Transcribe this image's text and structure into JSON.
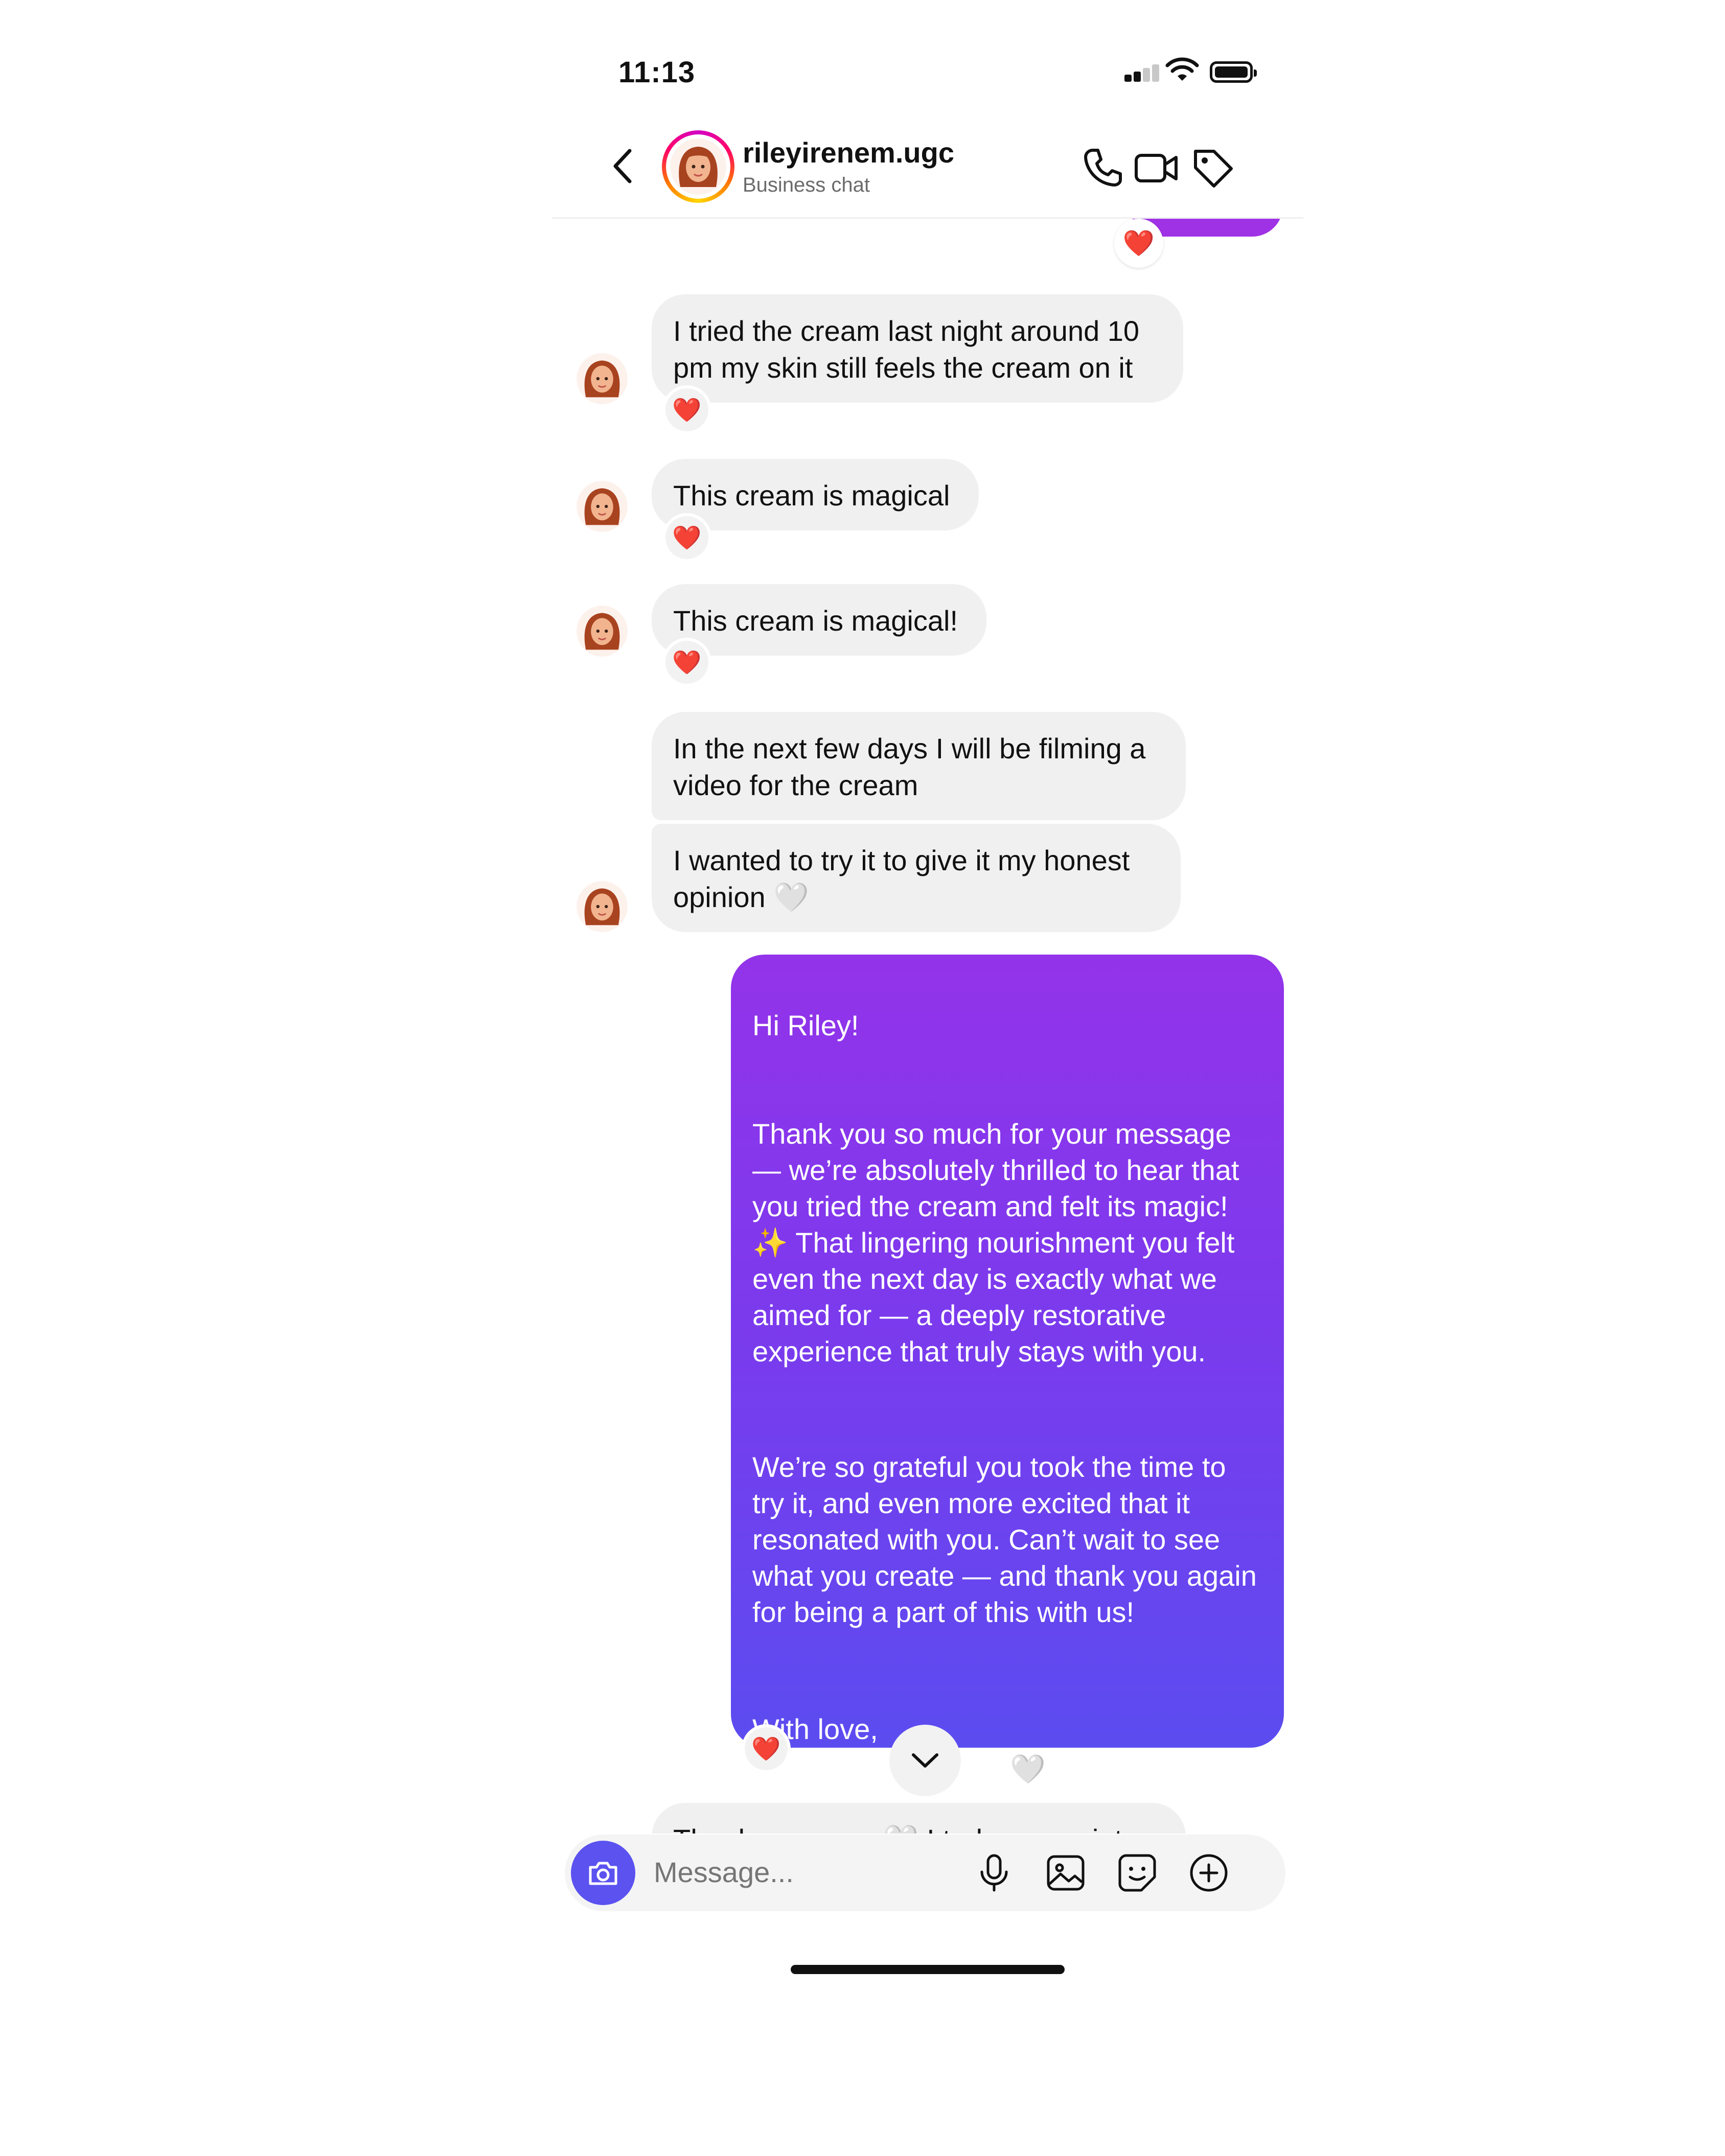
{
  "status_bar": {
    "time": "11:13"
  },
  "header": {
    "username": "rileyirenem.ugc",
    "subtitle": "Business chat",
    "icons": [
      "back-chevron-icon",
      "phone-icon",
      "video-camera-icon",
      "tag-icon"
    ]
  },
  "messages": {
    "m1": "I tried the cream last night around 10 pm my skin still feels the cream on it",
    "m2": "This cream is magical",
    "m3": "This cream is magical!",
    "m4": "In the next few days I will be filming a video for the cream",
    "m5": "I wanted to try it to give it my honest opinion 🤍",
    "reply": {
      "p1": "Hi Riley!",
      "p2": "Thank you so much for your message — we’re absolutely thrilled to hear that you tried the cream and felt its magic! ✨ That lingering nourishment you felt even the next day is exactly what we aimed for — a deeply restorative experience that truly stays with you.",
      "p3": "We’re so grateful you took the time to try it, and even more excited that it resonated with you. Can’t wait to see what you create — and thank you again for being a part of this with us!",
      "p4": "With love,\nStephanie & Luesha🤍\nCo-founders\nAuriel Skin"
    },
    "partial": "Thank you guys 🤍 I truly appreciate"
  },
  "reactions": {
    "heart": "❤️"
  },
  "composer": {
    "placeholder": "Message...",
    "icons": [
      "camera-icon",
      "microphone-icon",
      "gallery-icon",
      "sticker-icon",
      "plus-circle-icon"
    ]
  },
  "colors": {
    "outgoing_top": "#9333ea",
    "outgoing_bottom": "#5b4cf0",
    "incoming": "#f0f0f0",
    "camera_button": "#5b52f0"
  }
}
